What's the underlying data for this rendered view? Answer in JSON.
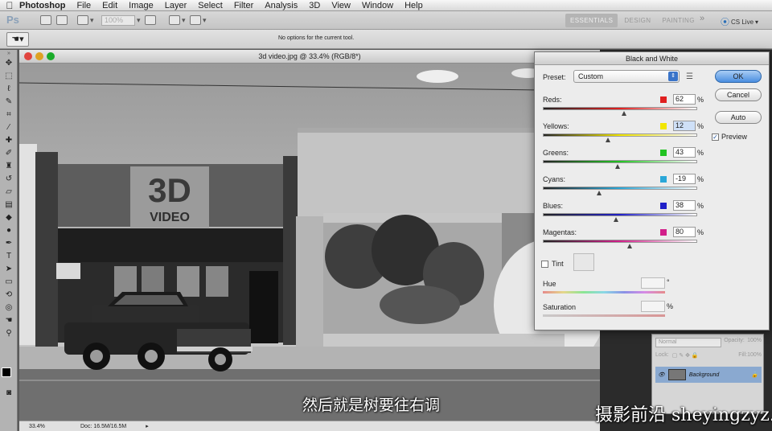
{
  "menubar": {
    "apple_icon": "apple-icon",
    "app_name": "Photoshop",
    "items": [
      "File",
      "Edit",
      "Image",
      "Layer",
      "Select",
      "Filter",
      "Analysis",
      "3D",
      "View",
      "Window",
      "Help"
    ]
  },
  "appbar": {
    "zoom_value": "100%",
    "workspaces": [
      "ESSENTIALS",
      "DESIGN",
      "PAINTING"
    ],
    "more": "»",
    "cs_live": "CS Live"
  },
  "options": {
    "message": "No options for the current tool."
  },
  "document": {
    "title": "3d video.jpg @ 33.4% (RGB/8*)",
    "sign_big": "3D",
    "sign_small": "VIDEO",
    "zoom": "33.4%",
    "doc_size": "Doc: 16.5M/16.5M"
  },
  "dialog": {
    "title": "Black and White",
    "preset_label": "Preset:",
    "preset_value": "Custom",
    "ok": "OK",
    "cancel": "Cancel",
    "auto": "Auto",
    "preview_label": "Preview",
    "preview_checked": true,
    "tint_label": "Tint",
    "hue_label": "Hue",
    "hue_unit": "°",
    "saturation_label": "Saturation",
    "saturation_unit": "%",
    "sliders": [
      {
        "label": "Reds:",
        "value": "62",
        "unit": "%",
        "color": "#e02020",
        "min": -200,
        "max": 300
      },
      {
        "label": "Yellows:",
        "value": "12",
        "unit": "%",
        "color": "#f2e600",
        "min": -200,
        "max": 300
      },
      {
        "label": "Greens:",
        "value": "43",
        "unit": "%",
        "color": "#22c322",
        "min": -200,
        "max": 300
      },
      {
        "label": "Cyans:",
        "value": "-19",
        "unit": "%",
        "color": "#2aa7d8",
        "min": -200,
        "max": 300
      },
      {
        "label": "Blues:",
        "value": "38",
        "unit": "%",
        "color": "#2020c8",
        "min": -200,
        "max": 300
      },
      {
        "label": "Magentas:",
        "value": "80",
        "unit": "%",
        "color": "#d21f8a",
        "min": -200,
        "max": 300
      }
    ]
  },
  "layers": {
    "blend_mode": "Normal",
    "opacity_label": "Opacity:",
    "opacity_value": "100%",
    "lock_label": "Lock:",
    "fill_label": "Fill:",
    "fill_value": "100%",
    "layer_name": "Background"
  },
  "subtitle": "然后就是树要往右调",
  "watermark": "摄影前沿 sheyingzyz.com"
}
